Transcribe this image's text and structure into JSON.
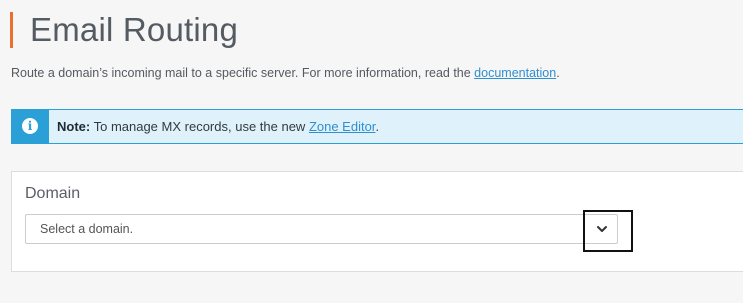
{
  "header": {
    "title": "Email Routing"
  },
  "description": {
    "text": "Route a domain’s incoming mail to a specific server. For more information, read the ",
    "link": "documentation",
    "suffix": "."
  },
  "callout": {
    "icon": "info-icon",
    "label": "Note:",
    "text": " To manage MX records, use the new ",
    "link": "Zone Editor",
    "suffix": "."
  },
  "domain_panel": {
    "label": "Domain",
    "select": {
      "selected": "Select a domain.",
      "icon": "chevron-down-icon"
    }
  },
  "colors": {
    "accent": "#e8722d",
    "info": "#2aa0d6",
    "link": "#2f8fcf"
  }
}
